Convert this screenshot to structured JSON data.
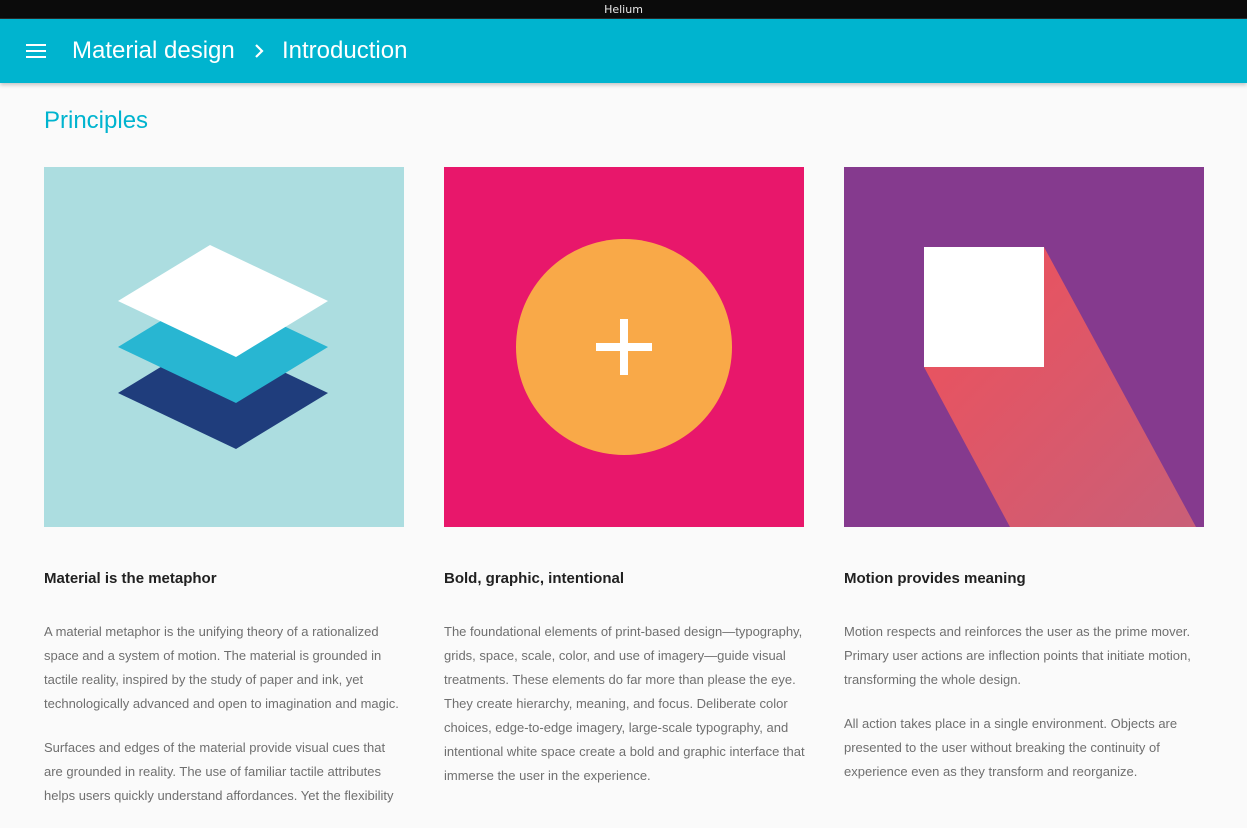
{
  "window": {
    "title": "Helium"
  },
  "appbar": {
    "menu_icon": "hamburger-menu-icon",
    "breadcrumb": {
      "parent": "Material design",
      "current": "Introduction"
    },
    "background_color": "#00b4cf"
  },
  "section": {
    "title": "Principles"
  },
  "cards": [
    {
      "title": "Material is the metaphor",
      "image_color": "#acdde0",
      "paragraphs": [
        "A material metaphor is the unifying theory of a rationalized space and a system of motion. The material is grounded in tactile reality, inspired by the study of paper and ink, yet technologically advanced and open to imagination and magic.",
        "Surfaces and edges of the material provide visual cues that are grounded in reality. The use of familiar tactile attributes helps users quickly understand affordances. Yet the flexibility"
      ]
    },
    {
      "title": "Bold, graphic, intentional",
      "image_color": "#e8176b",
      "paragraphs": [
        "The foundational elements of print-based design—typography, grids, space, scale, color, and use of imagery—guide visual treatments. These elements do far more than please the eye. They create hierarchy, meaning, and focus. Deliberate color choices, edge-to-edge imagery, large-scale typography, and intentional white space create a bold and graphic interface that immerse the user in the experience."
      ]
    },
    {
      "title": "Motion provides meaning",
      "image_color": "#853a8e",
      "paragraphs": [
        "Motion respects and reinforces the user as the prime mover. Primary user actions are inflection points that initiate motion, transforming the whole design.",
        "All action takes place in a single environment. Objects are presented to the user without breaking the continuity of experience even as they transform and reorganize."
      ]
    }
  ]
}
